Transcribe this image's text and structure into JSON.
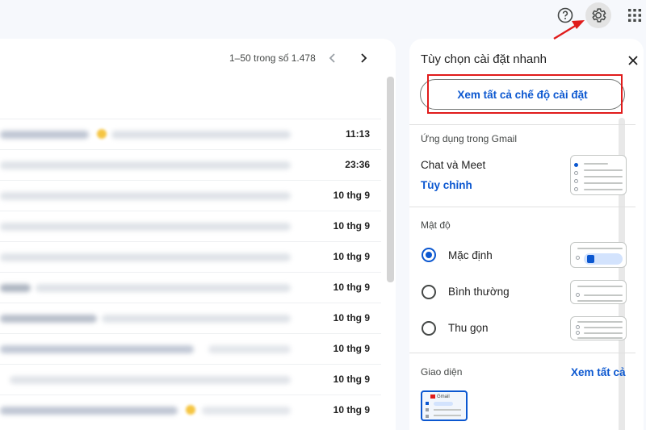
{
  "topbar": {
    "help_icon": "help-circle-icon",
    "settings_icon": "gear-icon",
    "apps_icon": "grid-apps-icon"
  },
  "mail_list": {
    "pagination": "1–50 trong số 1.478",
    "rows": [
      {
        "date": "11:13"
      },
      {
        "date": "23:36"
      },
      {
        "date": "10 thg 9"
      },
      {
        "date": "10 thg 9"
      },
      {
        "date": "10 thg 9"
      },
      {
        "date": "10 thg 9"
      },
      {
        "date": "10 thg 9"
      },
      {
        "date": "10 thg 9"
      },
      {
        "date": "10 thg 9"
      },
      {
        "date": "10 thg 9"
      }
    ]
  },
  "quick_settings": {
    "title": "Tùy chọn cài đặt nhanh",
    "see_all_settings": "Xem tất cả chế độ cài đặt",
    "apps_section": {
      "title": "Ứng dụng trong Gmail",
      "label": "Chat và Meet",
      "customize": "Tùy chỉnh"
    },
    "density_section": {
      "title": "Mật độ",
      "options": [
        {
          "label": "Mặc định",
          "checked": true
        },
        {
          "label": "Bình thường",
          "checked": false
        },
        {
          "label": "Thu gọn",
          "checked": false
        }
      ]
    },
    "theme_section": {
      "title": "Giao diện",
      "see_all": "Xem tất cả",
      "thumbnail_text": "Gmail"
    }
  },
  "colors": {
    "accent": "#0b57d0",
    "highlight": "#e01b1b"
  }
}
